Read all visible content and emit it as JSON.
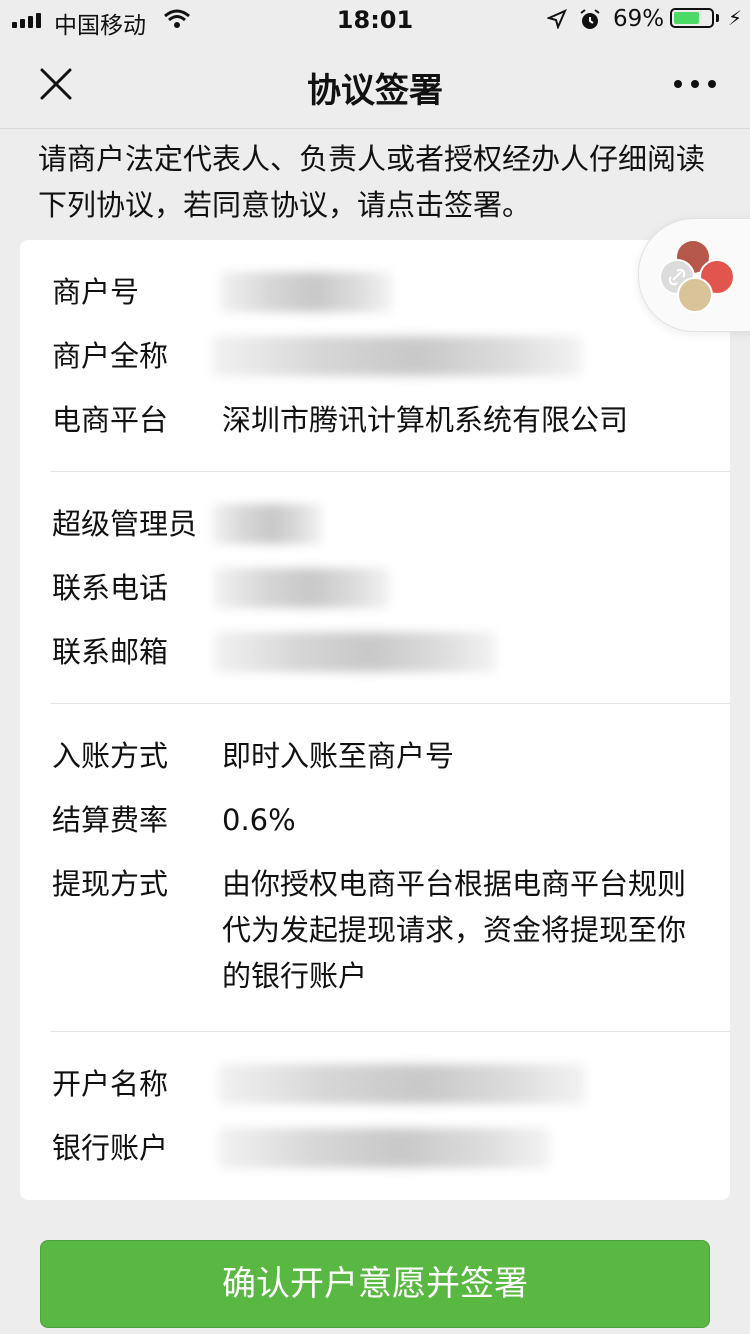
{
  "status_bar": {
    "carrier": "中国移动",
    "time": "18:01",
    "battery_percent": "69%",
    "battery_level": 0.69,
    "battery_color": "#4cd964"
  },
  "nav": {
    "title": "协议签署",
    "close_icon": "close-icon",
    "more_icon": "more-icon"
  },
  "intro": "请商户法定代表人、负责人或者授权经办人仔细阅读下列协议，若同意协议，请点击签署。",
  "merchant": {
    "id_label": "商户号",
    "full_name_label": "商户全称",
    "platform_label": "电商平台",
    "platform_value": "深圳市腾讯计算机系统有限公司"
  },
  "admin": {
    "admin_label": "超级管理员",
    "phone_label": "联系电话",
    "email_label": "联系邮箱"
  },
  "settlement": {
    "method_label": "入账方式",
    "method_value": "即时入账至商户号",
    "rate_label": "结算费率",
    "rate_value": "0.6%",
    "withdraw_label": "提现方式",
    "withdraw_value": "由你授权电商平台根据电商平台规则代为发起提现请求，资金将提现至你的银行账户"
  },
  "bank": {
    "account_name_label": "开户名称",
    "account_label": "银行账户"
  },
  "confirm_button": "确认开户意愿并签署",
  "colors": {
    "primary_green": "#59b841",
    "background": "#ededed"
  }
}
